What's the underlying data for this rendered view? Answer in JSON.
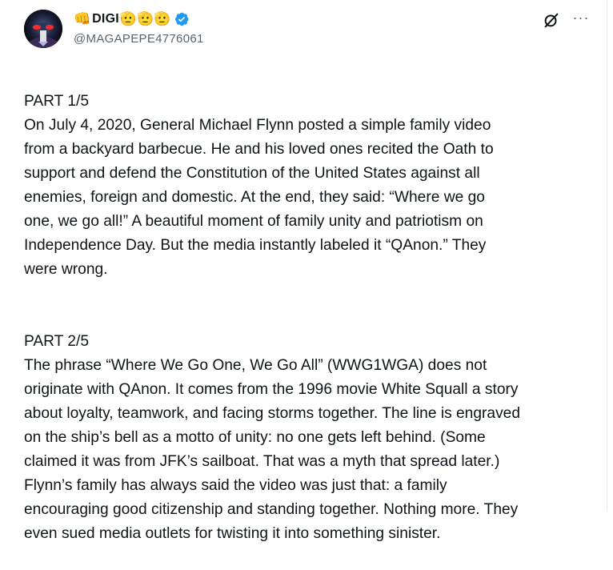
{
  "author": {
    "display_name": "DIGI",
    "handle": "@MAGAPEPE4776061",
    "verified": true,
    "emoji_prefix": "👊",
    "emoji_suffix": [
      "🫡",
      "🫡",
      "🫡"
    ]
  },
  "icons": {
    "verified_badge": "verified-badge-icon",
    "grok": "grok-icon",
    "more": "more-icon"
  },
  "more_glyph": "···",
  "post": {
    "paragraphs": [
      "PART 1/5\nOn July 4, 2020, General Michael Flynn posted a simple family video\nfrom a backyard barbecue.  He and his loved ones recited the Oath to\nsupport and defend the Constitution of the United States against all\nenemies, foreign and domestic.  At the end, they said: “Where we go\none, we go all!”  A beautiful moment of family unity and patriotism on\nIndependence Day.   But the media instantly labeled it “QAnon.”  They\nwere wrong.",
      "PART  2/5\nThe phrase “Where We Go One, We Go All” (WWG1WGA) does not\noriginate with QAnon.  It comes from the 1996 movie White Squall a story\nabout loyalty, teamwork, and facing storms together. The line is engraved\non the ship’s bell as a motto of unity: no one gets left behind.  (Some\nclaimed it was from JFK’s sailboat. That was a myth that spread later.)\nFlynn’s family has always said the video was just that: a family\nencouraging good citizenship and standing together. Nothing more. They\neven sued media outlets for twisting it into something sinister."
    ]
  },
  "colors": {
    "text": "#0f1419",
    "secondary": "#536471",
    "verified": "#1d9bf0"
  }
}
